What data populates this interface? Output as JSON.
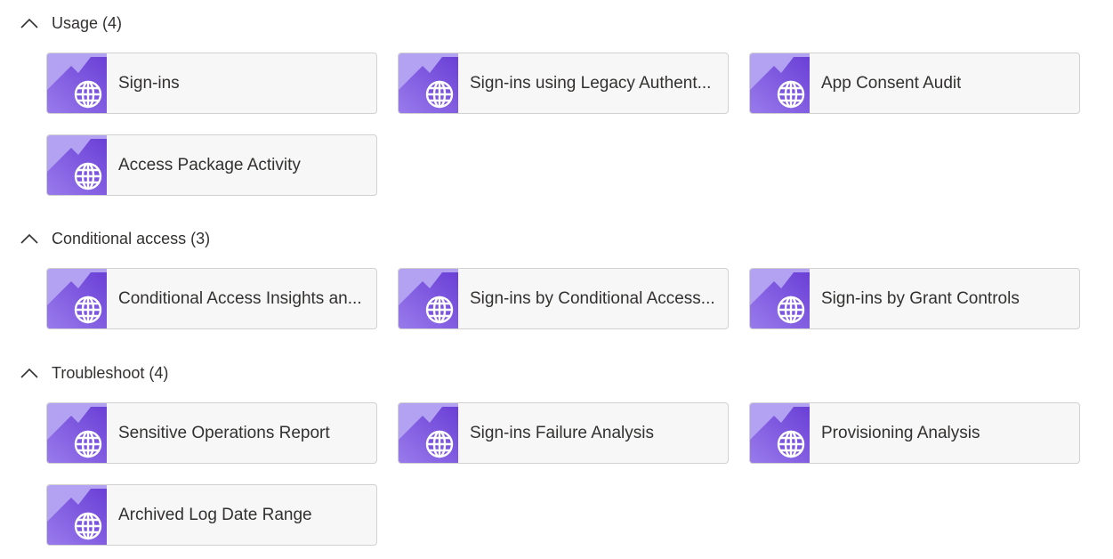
{
  "sections": [
    {
      "title": "Usage (4)",
      "items": [
        "Sign-ins",
        "Sign-ins using Legacy Authent...",
        "App Consent Audit",
        "Access Package Activity"
      ]
    },
    {
      "title": "Conditional access (3)",
      "items": [
        "Conditional Access Insights an...",
        "Sign-ins by Conditional Access...",
        "Sign-ins by Grant Controls"
      ]
    },
    {
      "title": "Troubleshoot (4)",
      "items": [
        "Sensitive Operations Report",
        "Sign-ins Failure Analysis",
        "Provisioning Analysis",
        "Archived Log Date Range"
      ]
    }
  ],
  "icons": {
    "section_toggle": "chevron-up-icon",
    "workbook": "workbook-globe-icon"
  },
  "colors": {
    "tile_light": "#b3a2f2",
    "tile_dark": "#6b46d8"
  }
}
